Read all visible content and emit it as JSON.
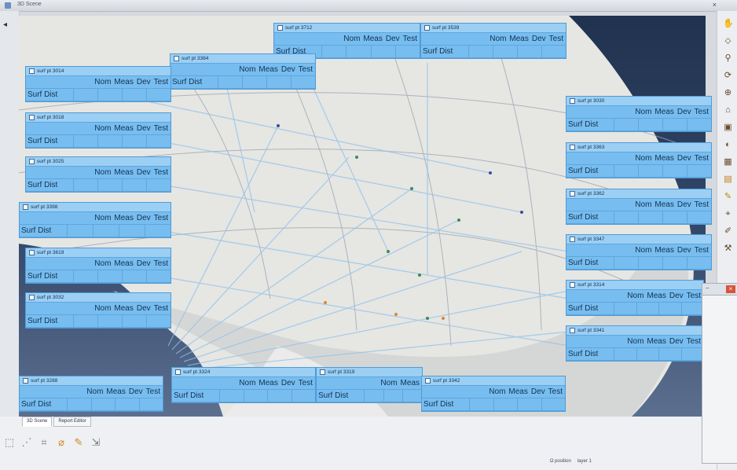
{
  "window": {
    "title": "3D Scene",
    "close_glyph": "×"
  },
  "panel_headers": {
    "nom": "Nom",
    "meas": "Meas",
    "dev": "Dev",
    "test": "Test"
  },
  "row_label": "Surf Dist",
  "panels": [
    {
      "id": "surf-pt-3712",
      "name": "surf pt 3712"
    },
    {
      "id": "surf-pt-3539",
      "name": "surf pt 3539"
    },
    {
      "id": "surf-pt-3384",
      "name": "surf pt 3384"
    },
    {
      "id": "surf-pt-3014",
      "name": "surf pt 3014"
    },
    {
      "id": "surf-pt-3018",
      "name": "surf pt 3018"
    },
    {
      "id": "surf-pt-3025",
      "name": "surf pt 3025"
    },
    {
      "id": "surf-pt-3398",
      "name": "surf pt 3398"
    },
    {
      "id": "surf-pt-3619",
      "name": "surf pt 3619"
    },
    {
      "id": "surf-pt-3032",
      "name": "surf pt 3032"
    },
    {
      "id": "surf-pt-3030",
      "name": "surf pt 3030"
    },
    {
      "id": "surf-pt-3363",
      "name": "surf pt 3363"
    },
    {
      "id": "surf-pt-3362",
      "name": "surf pt 3362"
    },
    {
      "id": "surf-pt-3347",
      "name": "surf pt 3347"
    },
    {
      "id": "surf-pt-3314",
      "name": "surf pt 3314"
    },
    {
      "id": "surf-pt-3341",
      "name": "surf pt 3341"
    },
    {
      "id": "surf-pt-3288",
      "name": "surf pt 3288"
    },
    {
      "id": "surf-pt-3324",
      "name": "surf pt 3324"
    },
    {
      "id": "surf-pt-3319",
      "name": "surf pt 3319"
    },
    {
      "id": "surf-pt-3342",
      "name": "surf pt 3342"
    }
  ],
  "bottom_tabs": [
    "3D Scene",
    "Report Editor"
  ],
  "toolbar_icons": [
    "select-icon",
    "point-icon",
    "feature-icon",
    "measure-icon",
    "label-icon",
    "export-icon"
  ],
  "statusbar": {
    "item1": "Ω position",
    "item2": "layer 1"
  },
  "right_tools": [
    "hand-icon",
    "pan-icon",
    "zoom-icon",
    "rotate-icon",
    "fit-icon",
    "view-icon",
    "layer-icon",
    "shade-icon",
    "grid-icon",
    "label-icon",
    "snap-icon",
    "pick-icon",
    "probe-icon"
  ],
  "colors": {
    "panel": "#77bdf0",
    "panel_header": "#9ccff4",
    "viewport_top": "#20324f",
    "part_surface": "#e6e6e3"
  }
}
